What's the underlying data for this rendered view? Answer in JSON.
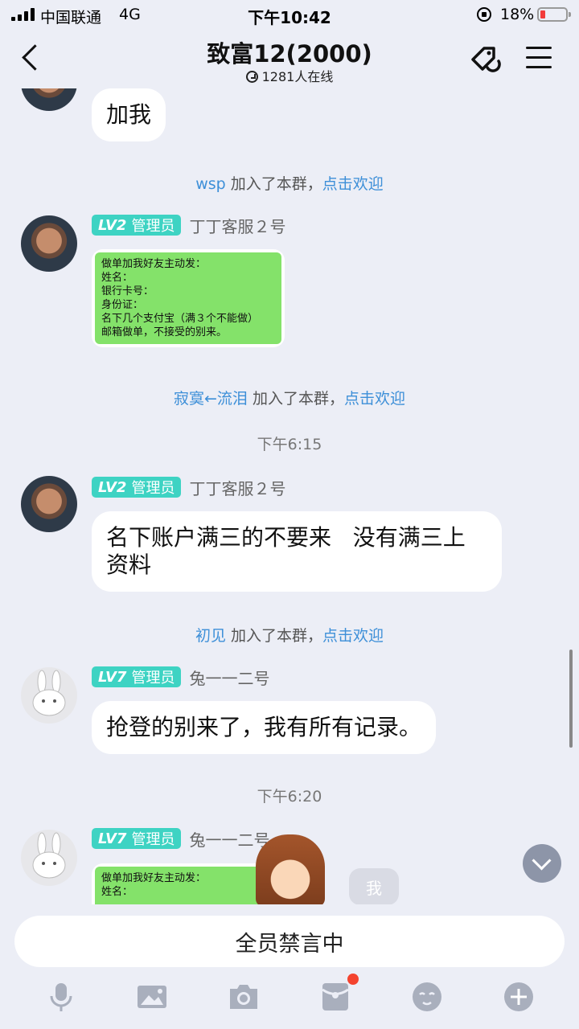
{
  "status_bar": {
    "carrier": "中国联通",
    "network": "4G",
    "time": "下午10:42",
    "battery": "18%"
  },
  "header": {
    "title": "致富12(2000)",
    "online": "1281人在线"
  },
  "messages": {
    "m1_text": "加我",
    "sys1": {
      "name": "wsp",
      "joined": "加入了本群，",
      "action": "点击欢迎"
    },
    "m2": {
      "level": "LV2",
      "role": "管理员",
      "sender": "丁丁客服２号",
      "image_lines": [
        "做单加我好友主动发：",
        "姓名：",
        "银行卡号：",
        "身份证：",
        "名下几个支付宝（满３个不能做）",
        "邮箱做单，不接受的别来。"
      ]
    },
    "sys2": {
      "name": "寂寞←流泪",
      "joined": "加入了本群，",
      "action": "点击欢迎"
    },
    "time1": "下午6:15",
    "m3": {
      "level": "LV2",
      "role": "管理员",
      "sender": "丁丁客服２号",
      "text_line1": "名下账户满三的不要来   没有满三上",
      "text_line2": "资料"
    },
    "sys3": {
      "name": "初见",
      "joined": "加入了本群，",
      "action": "点击欢迎"
    },
    "m4": {
      "level": "LV7",
      "role": "管理员",
      "sender": "兔一一二号",
      "text": "抢登的别来了，我有所有记录。"
    },
    "time2": "下午6:20",
    "m5": {
      "level": "LV7",
      "role": "管理员",
      "sender": "兔一一二号",
      "image_lines": [
        "做单加我好友主动发：",
        "姓名："
      ]
    },
    "chip_label": "我"
  },
  "bottom": {
    "mute_text": "全员禁言中"
  },
  "icons": {
    "toolbar": [
      "microphone-icon",
      "image-icon",
      "camera-icon",
      "red-packet-icon",
      "emoji-icon",
      "plus-icon"
    ]
  }
}
